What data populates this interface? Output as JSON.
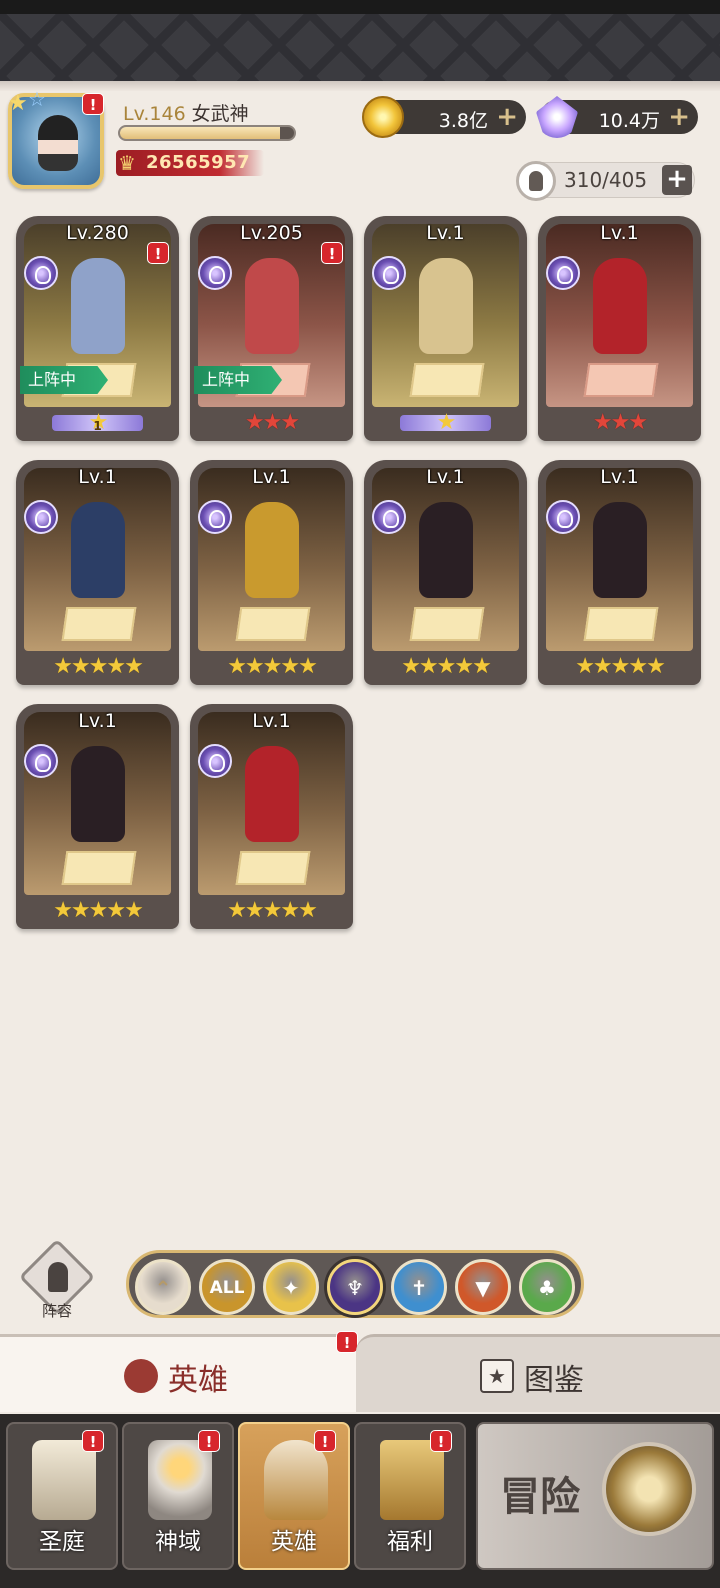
{
  "player": {
    "level": "Lv.146",
    "title": "女武神",
    "xp_fraction": 0.92,
    "power": "26565957"
  },
  "resources": {
    "gold": "3.8亿",
    "gems": "10.4万",
    "hero_slots": "310/405",
    "plus": "+"
  },
  "heroes": [
    {
      "level": "Lv.280",
      "deployed": true,
      "stars": "★",
      "star_badge": "1",
      "star_color": "purple",
      "bg": "gold",
      "alert": true,
      "hero_color": "#8fa2c9"
    },
    {
      "level": "Lv.205",
      "deployed": true,
      "stars": "★★★",
      "star_color": "red",
      "bg": "red",
      "alert": true,
      "hero_color": "#c0494a"
    },
    {
      "level": "Lv.1",
      "deployed": false,
      "stars": "★",
      "star_color": "purple",
      "bg": "gold",
      "alert": false,
      "hero_color": "#d8c38f"
    },
    {
      "level": "Lv.1",
      "deployed": false,
      "stars": "★★★",
      "star_color": "red",
      "bg": "red",
      "alert": false,
      "hero_color": "#b3232a"
    },
    {
      "level": "Lv.1",
      "deployed": false,
      "stars": "★★★★★",
      "star_color": "gold",
      "bg": "brown",
      "alert": false,
      "hero_color": "#2c3e66"
    },
    {
      "level": "Lv.1",
      "deployed": false,
      "stars": "★★★★★",
      "star_color": "gold",
      "bg": "brown",
      "alert": false,
      "hero_color": "#c99a2e"
    },
    {
      "level": "Lv.1",
      "deployed": false,
      "stars": "★★★★★",
      "star_color": "gold",
      "bg": "brown",
      "alert": false,
      "hero_color": "#2a1f24"
    },
    {
      "level": "Lv.1",
      "deployed": false,
      "stars": "★★★★★",
      "star_color": "gold",
      "bg": "brown",
      "alert": false,
      "hero_color": "#2a1f24"
    },
    {
      "level": "Lv.1",
      "deployed": false,
      "stars": "★★★★★",
      "star_color": "gold",
      "bg": "brown",
      "alert": false,
      "hero_color": "#2a1f24"
    },
    {
      "level": "Lv.1",
      "deployed": false,
      "stars": "★★★★★",
      "star_color": "gold",
      "bg": "brown",
      "alert": false,
      "hero_color": "#b3232a"
    }
  ],
  "deployed_label": "上阵中",
  "lineup_label": "阵容",
  "filters": [
    {
      "icon": "chevron-up-icon",
      "glyph": "⌃",
      "color": "#e6dccd"
    },
    {
      "icon": "all-icon",
      "glyph": "ALL",
      "color": "#c9952c"
    },
    {
      "icon": "light-icon",
      "glyph": "✦",
      "color": "#e8c24a"
    },
    {
      "icon": "dark-icon",
      "glyph": "♆",
      "color": "#4b3584"
    },
    {
      "icon": "sword-icon",
      "glyph": "✝",
      "color": "#3f8fcf"
    },
    {
      "icon": "wolf-icon",
      "glyph": "▼",
      "color": "#d0582a"
    },
    {
      "icon": "tree-icon",
      "glyph": "♣",
      "color": "#5aa94b"
    }
  ],
  "tabs": {
    "heroes": "英雄",
    "codex": "图鉴"
  },
  "nav": {
    "court": "圣庭",
    "domain": "神域",
    "heroes": "英雄",
    "welfare": "福利",
    "adventure": "冒险"
  },
  "alert_glyph": "!"
}
